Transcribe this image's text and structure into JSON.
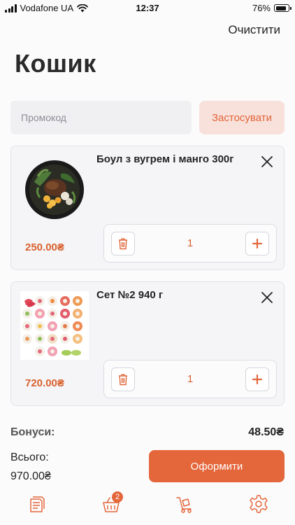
{
  "status_bar": {
    "carrier": "Vodafone UA",
    "time": "12:37",
    "battery": "76%"
  },
  "header": {
    "clear_label": "Очистити",
    "title": "Кошик"
  },
  "promo": {
    "placeholder": "Промокод",
    "apply_label": "Застосувати"
  },
  "items": [
    {
      "name": "Боул з вугрем і манго 300г",
      "price": "250.00₴",
      "quantity": "1"
    },
    {
      "name": "Сет №2 940 г",
      "price": "720.00₴",
      "quantity": "1"
    }
  ],
  "summary": {
    "bonus_label": "Бонуси:",
    "bonus_value": "48.50₴",
    "total_label": "Всього:",
    "total_value": "970.00₴",
    "checkout_label": "Оформити"
  },
  "tab_bar": {
    "cart_badge": "2",
    "tabs": [
      "menu-icon",
      "basket-icon",
      "delivery-cart-icon",
      "settings-icon"
    ]
  },
  "colors": {
    "accent": "#e4663b",
    "accent_light": "#f8e1da",
    "price": "#d9612e"
  }
}
